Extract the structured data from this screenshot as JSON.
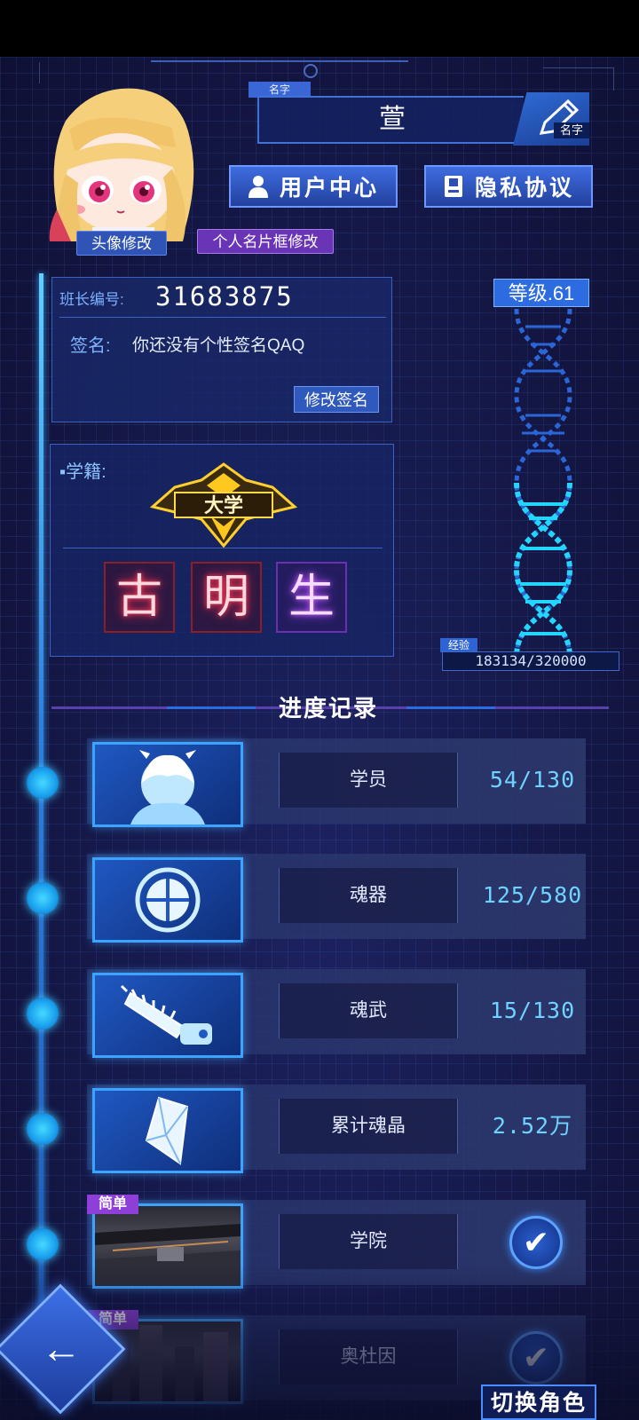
{
  "header": {
    "name_tag": "名字",
    "player_name": "萱",
    "name_edit_label": "名字",
    "avatar_edit": "头像修改",
    "card_frame_edit": "个人名片框修改",
    "user_center": "用户中心",
    "privacy": "隐私协议"
  },
  "info": {
    "id_label": "班长编号:",
    "id_value": "31683875",
    "sig_label": "签名:",
    "sig_value": "你还没有个性签名QAQ",
    "edit_sig": "修改签名"
  },
  "school": {
    "label": "学籍:",
    "badge": "大学",
    "rank": [
      "古",
      "明",
      "生"
    ]
  },
  "level": {
    "label": "等级.61",
    "exp_label": "经验",
    "exp_value": "183134/320000"
  },
  "progress": {
    "title": "进度记录",
    "rows": [
      {
        "name": "学员",
        "count": "54/130",
        "icon": "student-icon"
      },
      {
        "name": "魂器",
        "count": "125/580",
        "icon": "soul-orb-icon"
      },
      {
        "name": "魂武",
        "count": "15/130",
        "icon": "chainsaw-icon"
      },
      {
        "name": "累计魂晶",
        "count": "2.52万",
        "icon": "crystal-icon"
      },
      {
        "name": "学院",
        "tag": "简单",
        "icon": "academy-photo"
      },
      {
        "name": "奥杜因",
        "tag": "简单",
        "icon": "city-photo"
      }
    ]
  },
  "footer": {
    "switch_role": "切换角色"
  },
  "colors": {
    "accent": "#3ea2ff",
    "count": "#6fd3ff",
    "purple": "#8e3fd8"
  }
}
